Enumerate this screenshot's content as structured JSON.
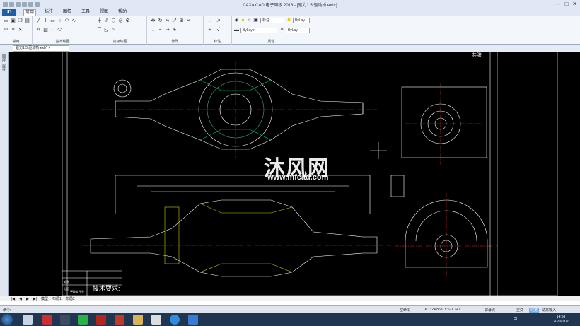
{
  "window": {
    "title": "CAXA CAD 电子图板 2016 - [驱力1.5t驱动桥.exb*]",
    "min": "—",
    "max": "□",
    "close": "✕"
  },
  "menu": {
    "app": "◧",
    "items": [
      "常用",
      "标注",
      "图幅",
      "工具",
      "视图",
      "帮助"
    ]
  },
  "ribbon": {
    "groups": [
      "常用",
      "基本绘图",
      "高级绘图",
      "修改",
      "标注",
      "属性"
    ],
    "combos": {
      "layer": "BYLAYER",
      "style": "标注",
      "color": "ByLay",
      "linetype": "ByLayer",
      "lineweight": "ByLay"
    }
  },
  "doctab": {
    "label": "驱力1.5t驱动桥.exb*",
    "close": "×"
  },
  "left_panel": [
    "图库",
    "属性"
  ],
  "drawing": {
    "watermark_cn": "沐风网",
    "watermark_url": "www.mfcad.com",
    "tech_req": "技术要求:",
    "title_cells": [
      "处数",
      "分区",
      "更改文件号"
    ],
    "top_right": "共张"
  },
  "layout_tabs": [
    "|◀",
    "◀",
    "▶",
    "▶|",
    "模型",
    "布局1",
    "布局2"
  ],
  "command": {
    "prompt": "命令:",
    "status_text": "空命令",
    "coords": "X:1324.863, Y:621.147",
    "snap": "屏幕点",
    "buttons": [
      "正交",
      "线宽",
      "动态输入"
    ]
  },
  "taskbar": {
    "time": "14:58",
    "date": "2020/11/7",
    "lang": "CH"
  }
}
